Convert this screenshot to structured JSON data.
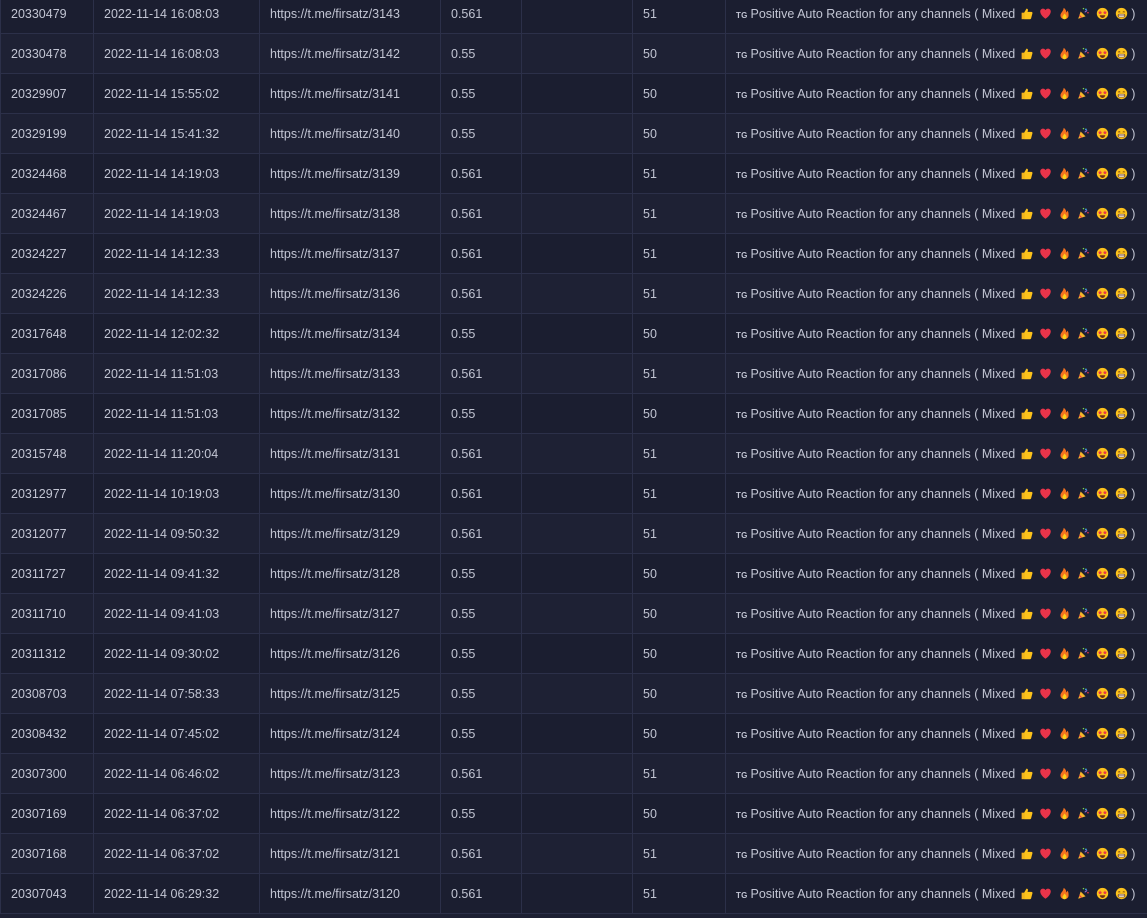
{
  "service": {
    "badge": "TG",
    "name": "Positive Auto Reaction for any channels ( Mixed",
    "close": ")",
    "emoji_icons": [
      "thumbs-up-icon",
      "red-heart-icon",
      "fire-icon",
      "party-popper-icon",
      "star-struck-icon",
      "beaming-face-icon"
    ]
  },
  "rows": [
    {
      "id": "20330479",
      "date": "2022-11-14 16:08:03",
      "link": "https://t.me/firsatz/3143",
      "charge": "0.561",
      "start_count": "",
      "quantity": "51"
    },
    {
      "id": "20330478",
      "date": "2022-11-14 16:08:03",
      "link": "https://t.me/firsatz/3142",
      "charge": "0.55",
      "start_count": "",
      "quantity": "50"
    },
    {
      "id": "20329907",
      "date": "2022-11-14 15:55:02",
      "link": "https://t.me/firsatz/3141",
      "charge": "0.55",
      "start_count": "",
      "quantity": "50"
    },
    {
      "id": "20329199",
      "date": "2022-11-14 15:41:32",
      "link": "https://t.me/firsatz/3140",
      "charge": "0.55",
      "start_count": "",
      "quantity": "50"
    },
    {
      "id": "20324468",
      "date": "2022-11-14 14:19:03",
      "link": "https://t.me/firsatz/3139",
      "charge": "0.561",
      "start_count": "",
      "quantity": "51"
    },
    {
      "id": "20324467",
      "date": "2022-11-14 14:19:03",
      "link": "https://t.me/firsatz/3138",
      "charge": "0.561",
      "start_count": "",
      "quantity": "51"
    },
    {
      "id": "20324227",
      "date": "2022-11-14 14:12:33",
      "link": "https://t.me/firsatz/3137",
      "charge": "0.561",
      "start_count": "",
      "quantity": "51"
    },
    {
      "id": "20324226",
      "date": "2022-11-14 14:12:33",
      "link": "https://t.me/firsatz/3136",
      "charge": "0.561",
      "start_count": "",
      "quantity": "51"
    },
    {
      "id": "20317648",
      "date": "2022-11-14 12:02:32",
      "link": "https://t.me/firsatz/3134",
      "charge": "0.55",
      "start_count": "",
      "quantity": "50"
    },
    {
      "id": "20317086",
      "date": "2022-11-14 11:51:03",
      "link": "https://t.me/firsatz/3133",
      "charge": "0.561",
      "start_count": "",
      "quantity": "51"
    },
    {
      "id": "20317085",
      "date": "2022-11-14 11:51:03",
      "link": "https://t.me/firsatz/3132",
      "charge": "0.55",
      "start_count": "",
      "quantity": "50"
    },
    {
      "id": "20315748",
      "date": "2022-11-14 11:20:04",
      "link": "https://t.me/firsatz/3131",
      "charge": "0.561",
      "start_count": "",
      "quantity": "51"
    },
    {
      "id": "20312977",
      "date": "2022-11-14 10:19:03",
      "link": "https://t.me/firsatz/3130",
      "charge": "0.561",
      "start_count": "",
      "quantity": "51"
    },
    {
      "id": "20312077",
      "date": "2022-11-14 09:50:32",
      "link": "https://t.me/firsatz/3129",
      "charge": "0.561",
      "start_count": "",
      "quantity": "51"
    },
    {
      "id": "20311727",
      "date": "2022-11-14 09:41:32",
      "link": "https://t.me/firsatz/3128",
      "charge": "0.55",
      "start_count": "",
      "quantity": "50"
    },
    {
      "id": "20311710",
      "date": "2022-11-14 09:41:03",
      "link": "https://t.me/firsatz/3127",
      "charge": "0.55",
      "start_count": "",
      "quantity": "50"
    },
    {
      "id": "20311312",
      "date": "2022-11-14 09:30:02",
      "link": "https://t.me/firsatz/3126",
      "charge": "0.55",
      "start_count": "",
      "quantity": "50"
    },
    {
      "id": "20308703",
      "date": "2022-11-14 07:58:33",
      "link": "https://t.me/firsatz/3125",
      "charge": "0.55",
      "start_count": "",
      "quantity": "50"
    },
    {
      "id": "20308432",
      "date": "2022-11-14 07:45:02",
      "link": "https://t.me/firsatz/3124",
      "charge": "0.55",
      "start_count": "",
      "quantity": "50"
    },
    {
      "id": "20307300",
      "date": "2022-11-14 06:46:02",
      "link": "https://t.me/firsatz/3123",
      "charge": "0.561",
      "start_count": "",
      "quantity": "51"
    },
    {
      "id": "20307169",
      "date": "2022-11-14 06:37:02",
      "link": "https://t.me/firsatz/3122",
      "charge": "0.55",
      "start_count": "",
      "quantity": "50"
    },
    {
      "id": "20307168",
      "date": "2022-11-14 06:37:02",
      "link": "https://t.me/firsatz/3121",
      "charge": "0.561",
      "start_count": "",
      "quantity": "51"
    },
    {
      "id": "20307043",
      "date": "2022-11-14 06:29:32",
      "link": "https://t.me/firsatz/3120",
      "charge": "0.561",
      "start_count": "",
      "quantity": "51"
    }
  ]
}
